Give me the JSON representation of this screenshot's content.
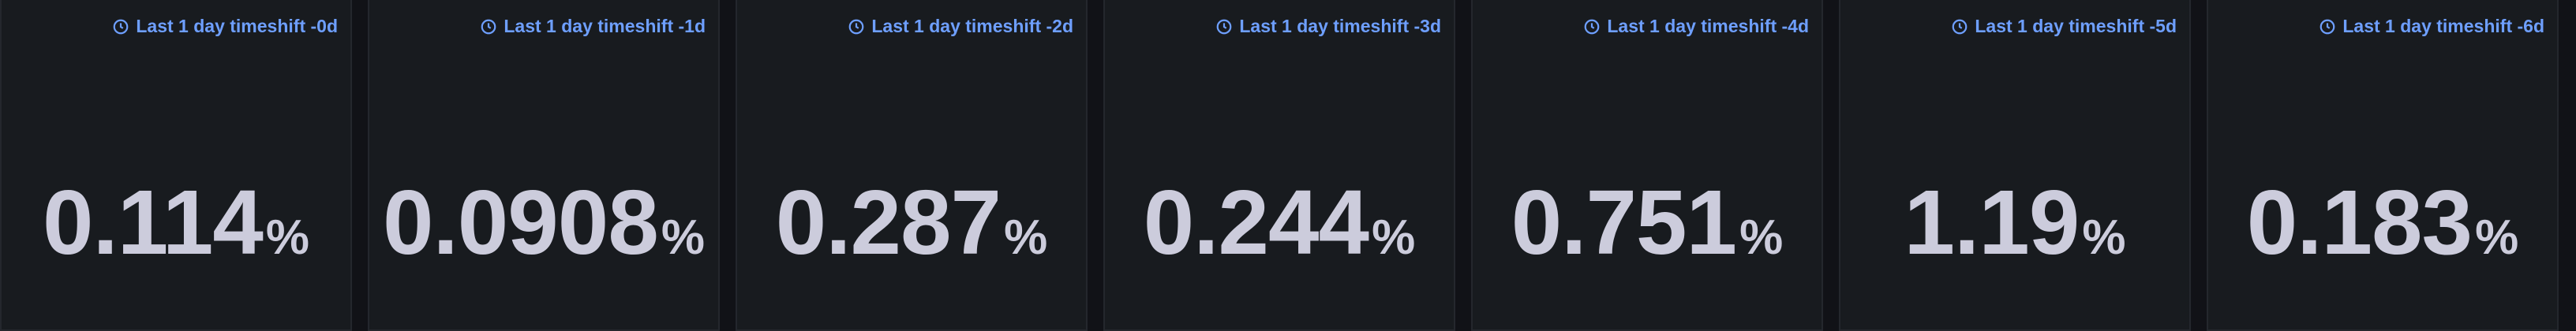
{
  "panels": [
    {
      "title": "Last 1 day timeshift -0d",
      "value": "0.114",
      "unit": "%"
    },
    {
      "title": "Last 1 day timeshift -1d",
      "value": "0.0908",
      "unit": "%"
    },
    {
      "title": "Last 1 day timeshift -2d",
      "value": "0.287",
      "unit": "%"
    },
    {
      "title": "Last 1 day timeshift -3d",
      "value": "0.244",
      "unit": "%"
    },
    {
      "title": "Last 1 day timeshift -4d",
      "value": "0.751",
      "unit": "%"
    },
    {
      "title": "Last 1 day timeshift -5d",
      "value": "1.19",
      "unit": "%"
    },
    {
      "title": "Last 1 day timeshift -6d",
      "value": "0.183",
      "unit": "%"
    }
  ],
  "colors": {
    "background": "#111217",
    "panel": "#181b1f",
    "panel_border": "#24272d",
    "header_link": "#6e9fff",
    "stat_text": "#ccccdc"
  },
  "icons": {
    "header_icon": "clock-icon"
  }
}
